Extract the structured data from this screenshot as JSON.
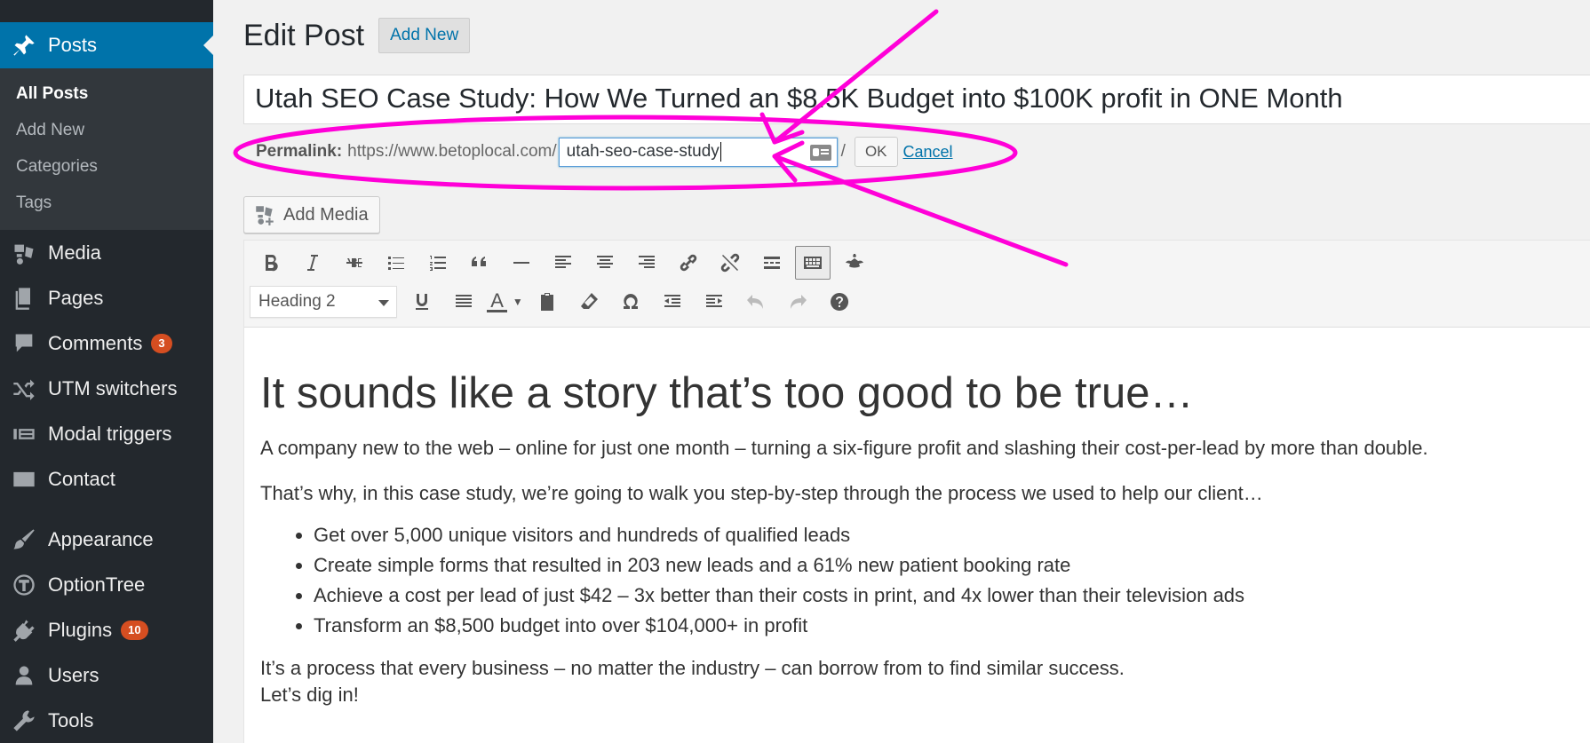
{
  "sidebar": {
    "posts_label": "Posts",
    "submenu": [
      "All Posts",
      "Add New",
      "Categories",
      "Tags"
    ],
    "items": [
      {
        "label": "Media",
        "icon": "media-icon"
      },
      {
        "label": "Pages",
        "icon": "pages-icon"
      },
      {
        "label": "Comments",
        "icon": "comments-icon",
        "badge": "3"
      },
      {
        "label": "UTM switchers",
        "icon": "shuffle-icon"
      },
      {
        "label": "Modal triggers",
        "icon": "modal-icon"
      },
      {
        "label": "Contact",
        "icon": "envelope-icon"
      },
      {
        "label": "Appearance",
        "icon": "brush-icon"
      },
      {
        "label": "OptionTree",
        "icon": "optiontree-icon"
      },
      {
        "label": "Plugins",
        "icon": "plug-icon",
        "badge": "10"
      },
      {
        "label": "Users",
        "icon": "user-icon"
      },
      {
        "label": "Tools",
        "icon": "wrench-icon"
      }
    ]
  },
  "header": {
    "title": "Edit Post",
    "add_new": "Add New"
  },
  "post": {
    "title": "Utah SEO Case Study: How We Turned an $8.5K Budget into $100K profit in ONE Month"
  },
  "permalink": {
    "label": "Permalink:",
    "base": "https://www.betoplocal.com/",
    "slug": "utah-seo-case-study",
    "trail": "/",
    "ok": "OK",
    "cancel": "Cancel"
  },
  "add_media": "Add Media",
  "toolbar": {
    "format": "Heading 2"
  },
  "content": {
    "heading": "It sounds like a story that’s too good to be true…",
    "p1": "A company new to the web – online for just one month – turning a six-figure profit and slashing their cost-per-lead by more than double.",
    "p2": "That’s why, in this case study, we’re going to walk you step-by-step through the process we used to help our client…",
    "bullets": [
      "Get over 5,000 unique visitors and hundreds of qualified leads",
      "Create simple forms that resulted in 203 new leads and a 61% new patient booking rate",
      "Achieve a cost per lead of just $42 – 3x better than their costs in print, and 4x lower than their television ads",
      "Transform an $8,500 budget into over $104,000+ in profit"
    ],
    "p3": "It’s a process that every business – no matter the industry – can borrow from to find similar success.",
    "p4": "Let’s dig in!"
  },
  "colors": {
    "sidebar_bg": "#23282d",
    "active_menu": "#0073aa",
    "badge": "#d54e21",
    "annotation": "#ff00d8"
  }
}
